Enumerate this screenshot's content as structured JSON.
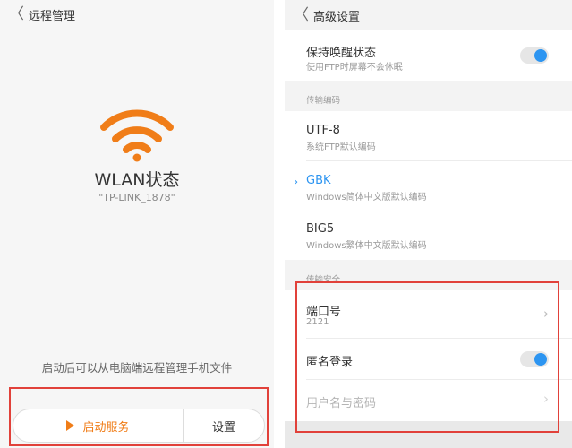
{
  "left": {
    "header": {
      "back": "〈",
      "title": "远程管理"
    },
    "status_title": "WLAN状态",
    "ssid": "\"TP-LINK_1878\"",
    "hint": "启动后可以从电脑端远程管理手机文件",
    "start_label": "启动服务",
    "settings_label": "设置",
    "accent_color": "#f07d18"
  },
  "right": {
    "header": {
      "back": "〈",
      "title": "高级设置"
    },
    "keep_awake": {
      "title": "保持唤醒状态",
      "subtitle": "使用FTP时屏幕不会休眠",
      "enabled": true
    },
    "encoding_section": "传输编码",
    "encodings": [
      {
        "name": "UTF-8",
        "desc": "系统FTP默认编码",
        "selected": false
      },
      {
        "name": "GBK",
        "desc": "Windows简体中文版默认编码",
        "selected": true
      },
      {
        "name": "BIG5",
        "desc": "Windows繁体中文版默认编码",
        "selected": false
      }
    ],
    "security_section": "传输安全",
    "port": {
      "title": "端口号",
      "value": "2121"
    },
    "anonymous": {
      "title": "匿名登录",
      "enabled": true
    },
    "credentials": {
      "title": "用户名与密码"
    },
    "accent_color": "#2d95f1"
  }
}
